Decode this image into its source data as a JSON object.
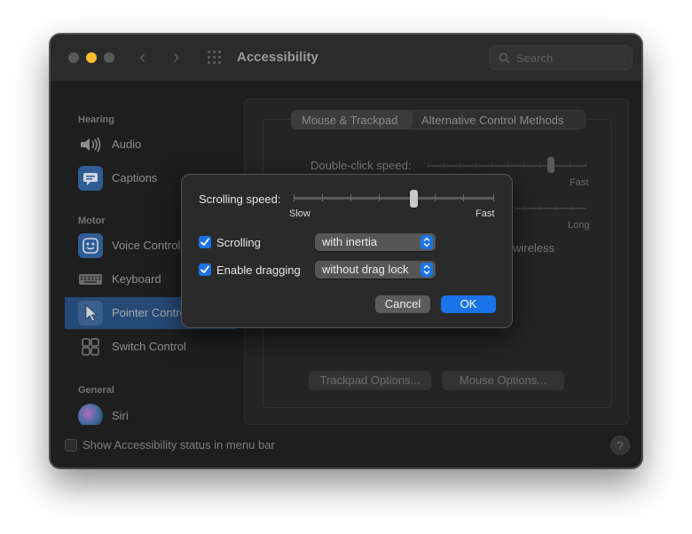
{
  "window": {
    "title": "Accessibility",
    "search_placeholder": "Search"
  },
  "sidebar": {
    "sections": [
      {
        "label": "Hearing"
      },
      {
        "label": "Motor"
      },
      {
        "label": "General"
      }
    ],
    "items": [
      {
        "label": "Audio",
        "icon": "speaker-icon"
      },
      {
        "label": "Captions",
        "icon": "captions-icon"
      },
      {
        "label": "Voice Control",
        "icon": "voice-control-icon"
      },
      {
        "label": "Keyboard",
        "icon": "keyboard-icon"
      },
      {
        "label": "Pointer Control",
        "icon": "pointer-icon",
        "selected": true
      },
      {
        "label": "Switch Control",
        "icon": "switch-control-icon"
      },
      {
        "label": "Siri",
        "icon": "siri-icon"
      }
    ]
  },
  "tabs": [
    {
      "label": "Mouse & Trackpad",
      "selected": true
    },
    {
      "label": "Alternative Control Methods"
    }
  ],
  "background": {
    "double_click_label": "Double-click speed:",
    "fast_label": "Fast",
    "long_label": "Long",
    "wireless_text": "wireless",
    "trackpad_options": "Trackpad Options...",
    "mouse_options": "Mouse Options...",
    "show_status": "Show Accessibility status in menu bar",
    "help": "?"
  },
  "dialog": {
    "scrolling_speed_label": "Scrolling speed:",
    "slow_label": "Slow",
    "fast_label": "Fast",
    "scrolling_speed_value": 0.6,
    "scrolling_label": "Scrolling",
    "scrolling_checked": true,
    "scrolling_option": "with inertia",
    "dragging_label": "Enable dragging",
    "dragging_checked": true,
    "dragging_option": "without drag lock",
    "cancel": "Cancel",
    "ok": "OK"
  },
  "colors": {
    "accent": "#1a73e8",
    "selected_row": "#264a78",
    "traffic_yellow": "#febc2e"
  }
}
